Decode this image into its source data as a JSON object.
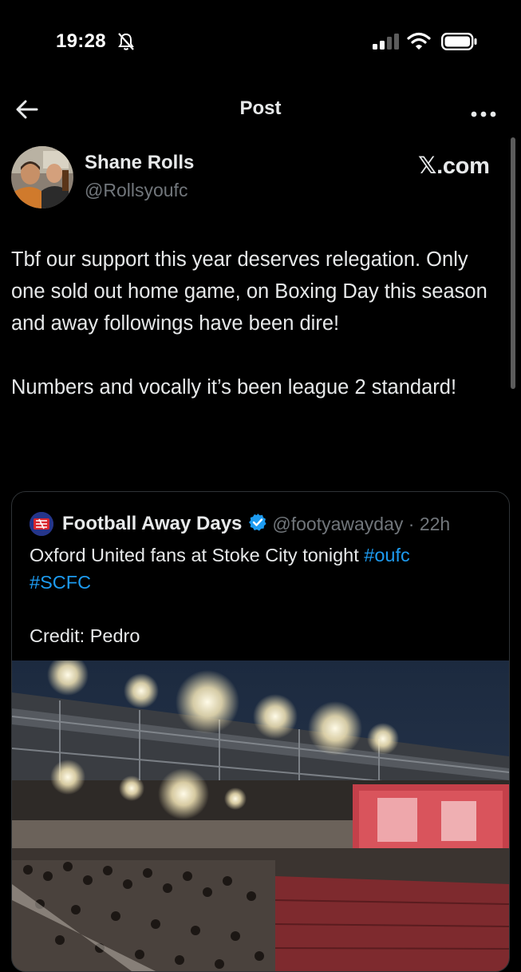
{
  "status_bar": {
    "time": "19:28",
    "icons": [
      "bell-slash-icon",
      "cellular-signal-icon",
      "wifi-icon",
      "battery-icon"
    ]
  },
  "nav": {
    "title": "Post",
    "back_icon": "arrow-left-icon",
    "more_icon": "more-horizontal-icon"
  },
  "post": {
    "author_name": "Shane Rolls",
    "author_handle": "@Rollsyoufc",
    "brand": "𝕏.com",
    "paragraphs": [
      "Tbf our support this year deserves relegation. Only one sold out home game, on Boxing Day this season and away followings have been dire!",
      "Numbers and vocally it’s been league 2 standard!"
    ]
  },
  "quote": {
    "name": "Football Away Days",
    "handle_time": "@footyawayday · 22h",
    "text_lead": "Oxford United fans at Stoke City tonight ",
    "hashtag_1": "#oufc",
    "hashtag_2": "#SCFC",
    "credit": "Credit: Pedro"
  },
  "colors": {
    "background": "#000000",
    "text": "#e7e9ea",
    "secondary_text": "#71767b",
    "link": "#1d9bf0",
    "border": "#2f3336"
  }
}
